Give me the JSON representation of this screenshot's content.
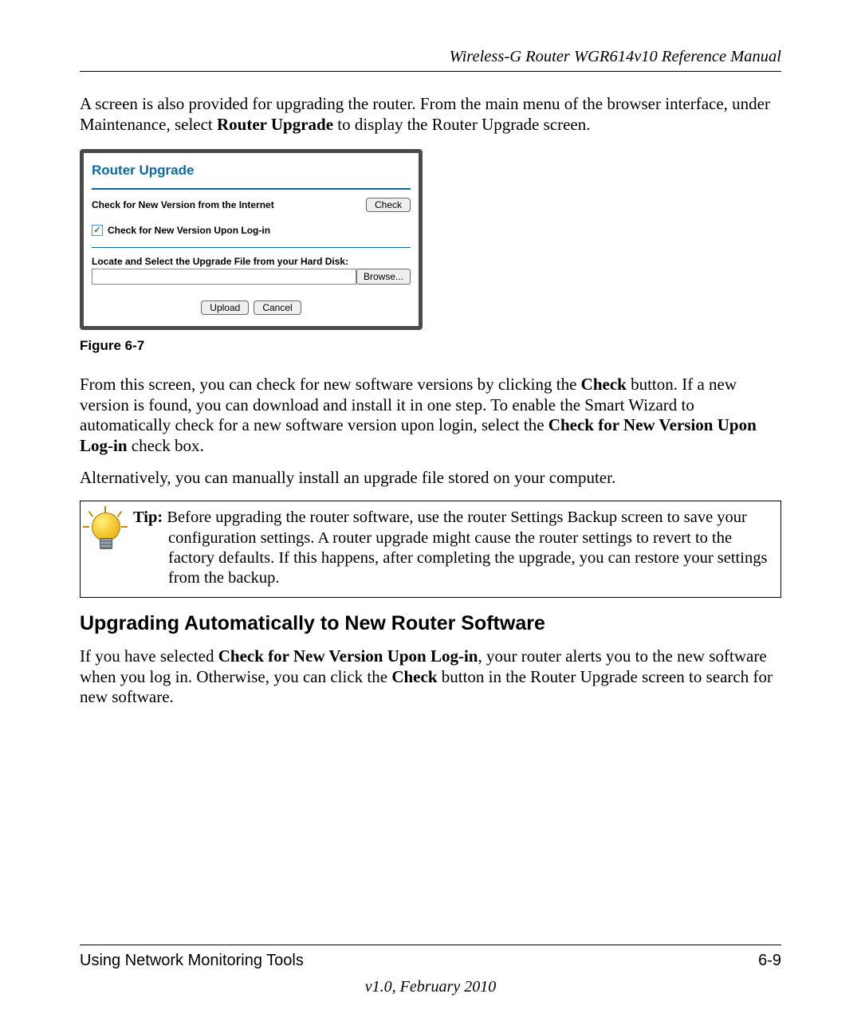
{
  "header": {
    "title": "Wireless-G Router WGR614v10 Reference Manual"
  },
  "para1": {
    "pre": "A screen is also provided for upgrading the router. From the main menu of the browser interface, under Maintenance, select ",
    "bold": "Router Upgrade",
    "post": " to display the Router Upgrade screen."
  },
  "figure": {
    "title": "Router Upgrade",
    "check_label": "Check for New Version from the Internet",
    "check_button": "Check",
    "checkbox_label": "Check for New Version Upon Log-in",
    "checkbox_checked": true,
    "locate_label": "Locate and Select the Upgrade File from your Hard Disk:",
    "browse_button": "Browse...",
    "upload_button": "Upload",
    "cancel_button": "Cancel",
    "caption": "Figure 6-7"
  },
  "para2": {
    "t1": "From this screen, you can check for new software versions by clicking the ",
    "b1": "Check",
    "t2": " button. If a new version is found, you can download and install it in one step. To enable the Smart Wizard to automatically check for a new software version upon login, select the ",
    "b2": "Check for New Version Upon Log-in",
    "t3": " check box."
  },
  "para3": "Alternatively, you can manually install an upgrade file stored on your computer.",
  "tip": {
    "label": "Tip:",
    "text": " Before upgrading the router software, use the router Settings Backup screen to save your configuration settings. A router upgrade might cause the router settings to revert to the factory defaults. If this happens, after completing the upgrade, you can restore your settings from the backup."
  },
  "heading": "Upgrading Automatically to New Router Software",
  "para4": {
    "t1": "If you have selected ",
    "b1": "Check for New Version Upon Log-in",
    "t2": ", your router alerts you to the new software when you log in. Otherwise, you can click the ",
    "b2": "Check",
    "t3": " button in the Router Upgrade screen to search for new software."
  },
  "footer": {
    "left": "Using Network Monitoring Tools",
    "right": "6-9",
    "version": "v1.0, February 2010"
  }
}
